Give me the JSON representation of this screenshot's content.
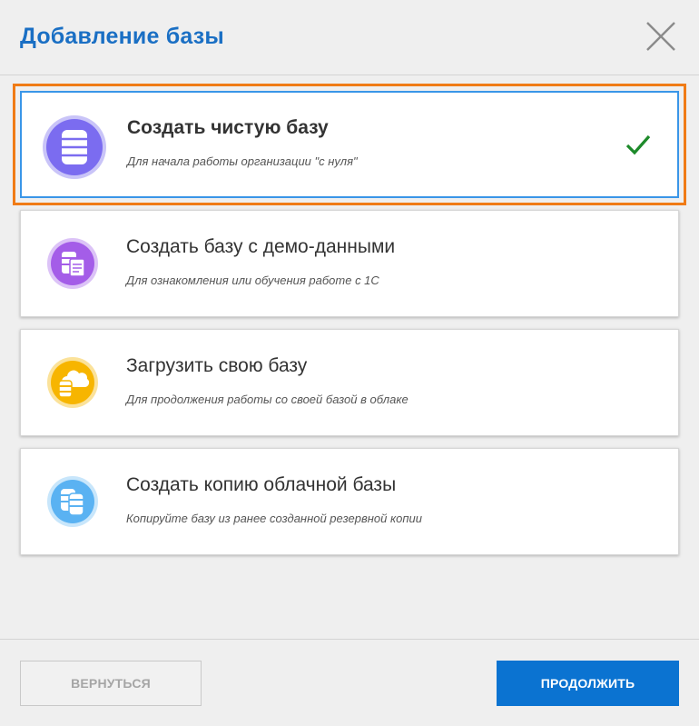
{
  "dialog": {
    "title": "Добавление базы"
  },
  "options": [
    {
      "title": "Создать чистую базу",
      "description": "Для начала работы организации \"с нуля\"",
      "icon": "database-icon",
      "color": "#7b6cf0",
      "selected": true
    },
    {
      "title": "Создать базу с демо-данными",
      "description": "Для ознакомления или обучения работе с 1С",
      "icon": "demo-database-icon",
      "color": "#a45de8",
      "selected": false
    },
    {
      "title": "Загрузить свою базу",
      "description": "Для продолжения работы со своей базой в облаке",
      "icon": "cloud-upload-database-icon",
      "color": "#f7b500",
      "selected": false
    },
    {
      "title": "Создать копию облачной базы",
      "description": "Копируйте базу из ранее созданной резервной копии",
      "icon": "copy-database-icon",
      "color": "#5ab2f2",
      "selected": false
    }
  ],
  "footer": {
    "back_label": "ВЕРНУТЬСЯ",
    "next_label": "ПРОДОЛЖИТЬ"
  },
  "colors": {
    "accent": "#0b73d1",
    "title": "#1a6fc4",
    "highlight": "#f07b16",
    "selected_border": "#3a96e8",
    "check": "#1d8a2a"
  }
}
